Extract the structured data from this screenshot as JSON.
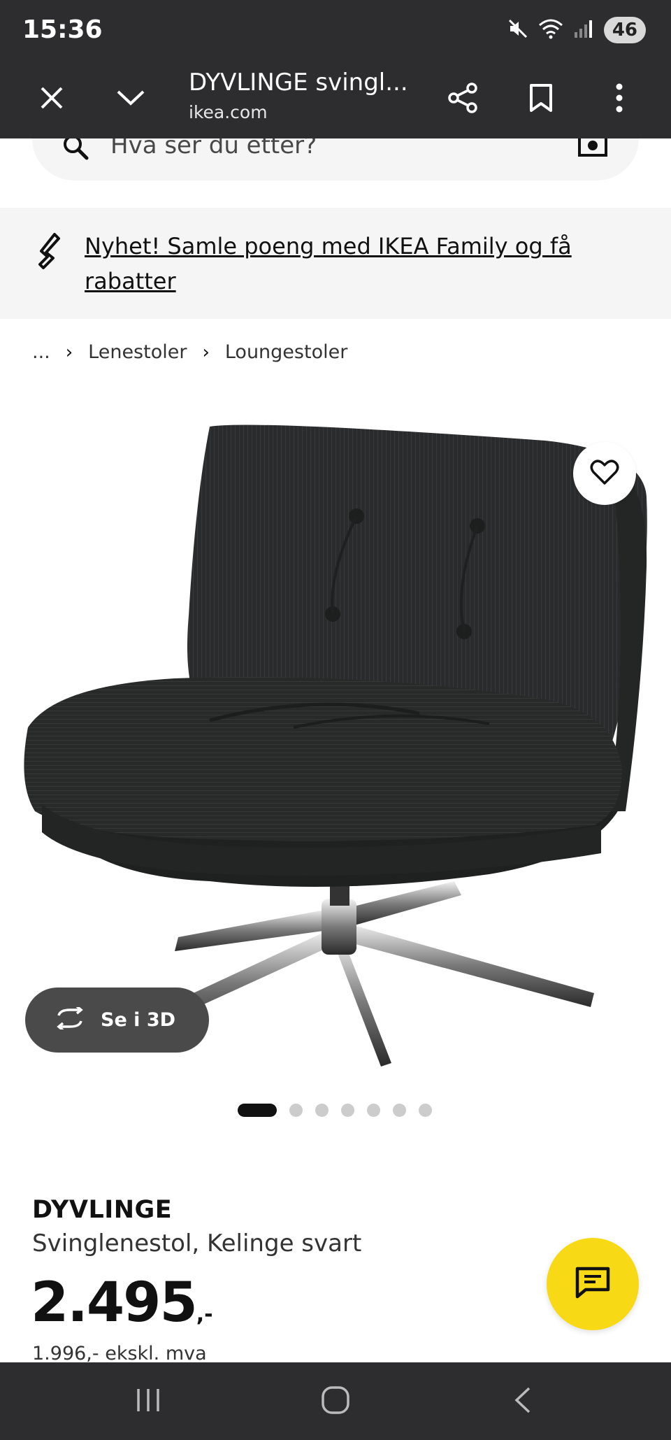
{
  "status_bar": {
    "time": "15:36",
    "battery": "46",
    "icons": [
      "mute-icon",
      "wifi-icon",
      "signal-icon"
    ]
  },
  "browser": {
    "title": "DYVLINGE svingl...",
    "domain": "ikea.com",
    "icons": [
      "close-icon",
      "chevron-down-icon",
      "share-icon",
      "bookmark-icon",
      "more-vert-icon"
    ]
  },
  "search": {
    "placeholder": "Hva ser du etter?"
  },
  "promo": {
    "text": "Nyhet! Samle poeng med IKEA Family og få rabatter"
  },
  "breadcrumb": {
    "ellipsis": "...",
    "items": [
      "Lenestoler",
      "Loungestoler"
    ]
  },
  "gallery": {
    "view_3d_label": "Se i 3D",
    "image_count": 7,
    "active_index": 0
  },
  "product": {
    "name": "DYVLINGE",
    "description": "Svinglenestol, Kelinge svart",
    "price": "2.495",
    "price_suffix": ",-",
    "price_ex_vat": "1.996,- ekskl. mva"
  },
  "colors": {
    "toolbar_bg": "#2d2d2f",
    "chat_button": "#f7d916",
    "banner_bg": "#f5f5f5"
  }
}
